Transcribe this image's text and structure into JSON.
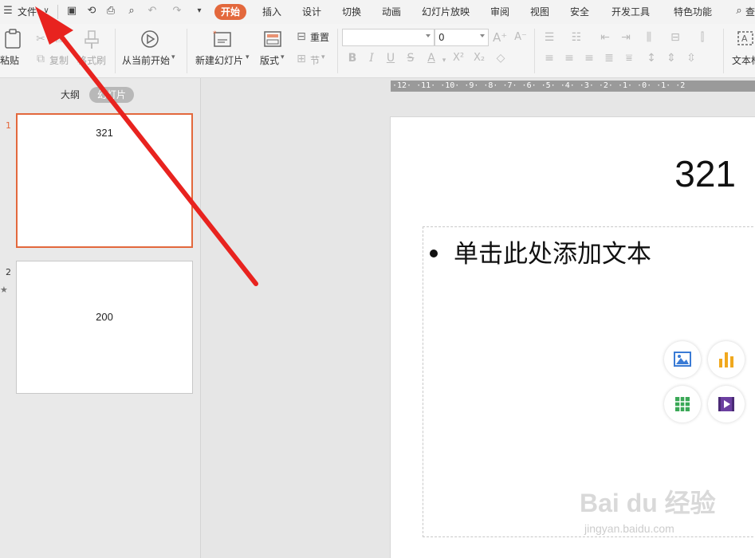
{
  "menubar": {
    "file_label": "文件",
    "tabs": [
      {
        "label": "开始",
        "active": true
      },
      {
        "label": "插入"
      },
      {
        "label": "设计"
      },
      {
        "label": "切换"
      },
      {
        "label": "动画"
      },
      {
        "label": "幻灯片放映"
      },
      {
        "label": "审阅"
      },
      {
        "label": "视图"
      },
      {
        "label": "安全"
      },
      {
        "label": "开发工具"
      },
      {
        "label": "特色功能"
      }
    ],
    "search_label": "查"
  },
  "ribbon": {
    "paste_label": "粘贴",
    "copy_label": "复制",
    "format_painter_label": "格式刷",
    "play_from_current_label": "从当前开始",
    "new_slide_label": "新建幻灯片",
    "layout_label": "版式",
    "reset_label": "重置",
    "section_label": "节",
    "font_name": "",
    "font_size": "0",
    "textbox_label": "文本框"
  },
  "left_panel": {
    "tab_outline": "大纲",
    "tab_slides": "幻灯片",
    "slides": [
      {
        "number": "1",
        "title": "321",
        "selected": true
      },
      {
        "number": "2",
        "title": "200",
        "selected": false
      }
    ]
  },
  "ruler": {
    "text": "·12· ·11· ·10· ·9· ·8· ·7· ·6· ·5· ·4· ·3· ·2· ·1· ·0· ·1· ·2"
  },
  "slide": {
    "title": "321",
    "placeholder": "单击此处添加文本"
  },
  "watermark": {
    "main": "Bai du 经验",
    "sub": "jingyan.baidu.com"
  },
  "colors": {
    "accent": "#e3683c",
    "arrow": "#e8231f"
  }
}
